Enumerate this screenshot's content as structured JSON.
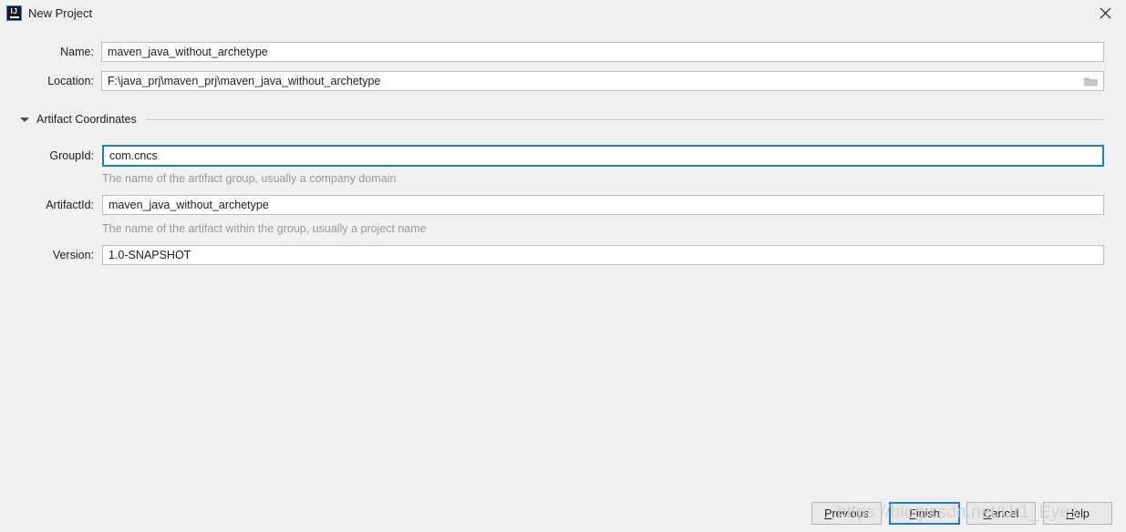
{
  "window": {
    "title": "New Project",
    "icon": "intellij-idea-icon",
    "icon_text": "IJ",
    "close_label": "✕"
  },
  "form": {
    "name": {
      "label": "Name:",
      "value": "maven_java_without_archetype",
      "placeholder": ""
    },
    "location": {
      "label": "Location:",
      "value": "F:\\java_prj\\maven_prj\\maven_java_without_archetype",
      "placeholder": "",
      "browse_icon": "folder-icon"
    }
  },
  "section": {
    "title": "Artifact Coordinates",
    "expanded": true,
    "twisty_icon": "chevron-down-icon"
  },
  "coordinates": {
    "group_id": {
      "label": "GroupId:",
      "value": "com.cncs",
      "hint": "The name of the artifact group, usually a company domain",
      "focused": true
    },
    "artifact_id": {
      "label": "ArtifactId:",
      "value": "maven_java_without_archetype",
      "hint": "The name of the artifact within the group, usually a project name",
      "focused": false
    },
    "version": {
      "label": "Version:",
      "value": "1.0-SNAPSHOT",
      "hint": "",
      "focused": false
    }
  },
  "buttons": {
    "previous": {
      "prefix": "",
      "mnemonic": "P",
      "suffix": "revious"
    },
    "finish": {
      "prefix": "",
      "mnemonic": "F",
      "suffix": "inish"
    },
    "cancel": {
      "prefix": "",
      "mnemonic": "C",
      "suffix": "ancel"
    },
    "help": {
      "prefix": "",
      "mnemonic": "H",
      "suffix": "elp"
    }
  },
  "watermark": {
    "text": "https://blog.csdn.net/Ur1_Eyes"
  },
  "colors": {
    "background": "#f0f0f0",
    "field_border": "#bcbcbc",
    "focus_blue": "#1a7ec8",
    "hint_gray": "#9a9a9a",
    "text": "#1e1e1e"
  }
}
